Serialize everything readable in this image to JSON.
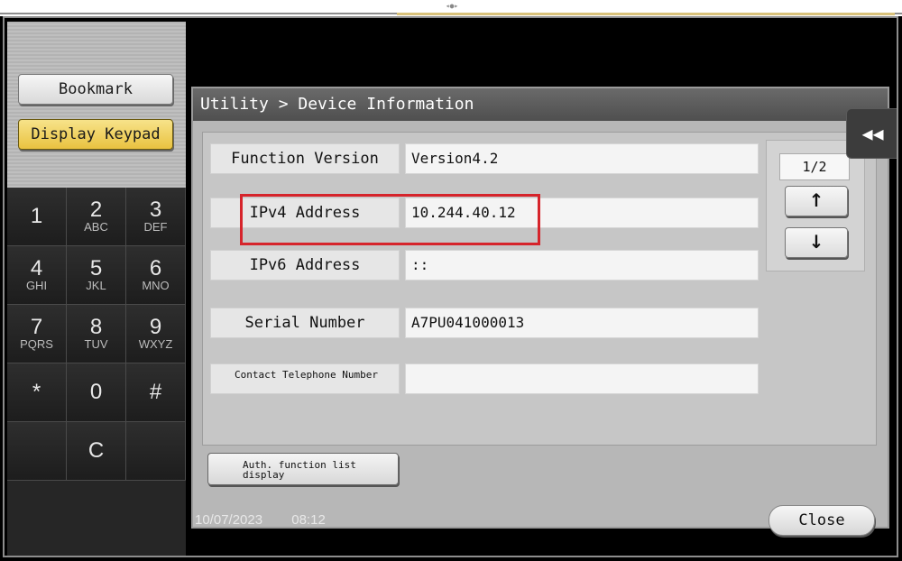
{
  "sidebar": {
    "bookmark_label": "Bookmark",
    "display_keypad_label": "Display Keypad",
    "keys": [
      {
        "digit": "1",
        "letters": ""
      },
      {
        "digit": "2",
        "letters": "ABC"
      },
      {
        "digit": "3",
        "letters": "DEF"
      },
      {
        "digit": "4",
        "letters": "GHI"
      },
      {
        "digit": "5",
        "letters": "JKL"
      },
      {
        "digit": "6",
        "letters": "MNO"
      },
      {
        "digit": "7",
        "letters": "PQRS"
      },
      {
        "digit": "8",
        "letters": "TUV"
      },
      {
        "digit": "9",
        "letters": "WXYZ"
      },
      {
        "digit": "*",
        "letters": ""
      },
      {
        "digit": "0",
        "letters": ""
      },
      {
        "digit": "#",
        "letters": ""
      },
      {
        "digit": "",
        "letters": ""
      },
      {
        "digit": "C",
        "letters": ""
      },
      {
        "digit": "",
        "letters": ""
      }
    ]
  },
  "window": {
    "title": "Utility > Device Information",
    "collapse_icon": "double-chevron-left-icon",
    "rows": [
      {
        "label": "Function Version",
        "value": "Version4.2"
      },
      {
        "label": "IPv4 Address",
        "value": "10.244.40.12"
      },
      {
        "label": "IPv6 Address",
        "value": "::"
      },
      {
        "label": "Serial Number",
        "value": "A7PU041000013"
      },
      {
        "label": "Contact Telephone Number",
        "value": ""
      }
    ],
    "pager": {
      "indicator": "1/2",
      "up_symbol": "↑",
      "down_symbol": "↓"
    },
    "auth_button_label": "Auth. function list display",
    "highlight_color": "#d6242b"
  },
  "status": {
    "date": "10/07/2023",
    "time": "08:12"
  },
  "close_label": "Close"
}
